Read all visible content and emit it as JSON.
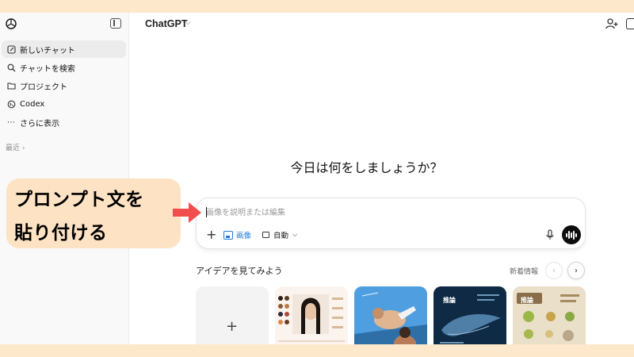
{
  "app": {
    "title": "ChatGPT"
  },
  "sidebar": {
    "items": [
      {
        "label": "新しいチャット",
        "icon": "edit-icon"
      },
      {
        "label": "チャットを検索",
        "icon": "search-icon"
      },
      {
        "label": "プロジェクト",
        "icon": "folder-icon"
      },
      {
        "label": "Codex",
        "icon": "codex-icon"
      },
      {
        "label": "さらに表示",
        "icon": "more-icon"
      }
    ],
    "recent_label": "最近 ›"
  },
  "main": {
    "greeting": "今日は何をしましょうか？",
    "composer": {
      "placeholder": "画像を説明または編集",
      "image_label": "画像",
      "mode_label": "自動"
    },
    "ideas": {
      "title": "アイデアを見てみよう",
      "news_label": "新着情報",
      "card_labels": [
        "推論",
        "推論"
      ]
    }
  },
  "annotation": {
    "line1": "プロンプト文を",
    "line2": "貼り付ける",
    "accent": "#f24e4e",
    "background": "#fde2c4"
  }
}
